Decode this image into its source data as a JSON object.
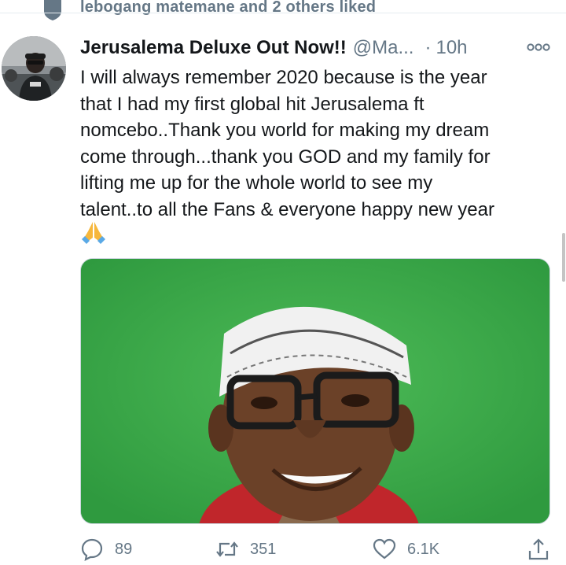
{
  "social_context": {
    "text": "lebogang matemane and 2 others liked",
    "icon": "heart-icon"
  },
  "tweet": {
    "display_name": "Jerusalema Deluxe Out Now!!",
    "handle": "@Ma...",
    "separator": "·",
    "time": "10h",
    "text": "I will always remember 2020 because is the year\nthat I had my first global hit Jerusalema ft\nnomcebo..Thank you world for making my dream\ncome through...thank you GOD and my family for\nlifting me up for the whole world to see my\ntalent..to all the Fans & everyone happy new year",
    "emoji": "folded-hands-emoji",
    "media_icon": "photo-portrait",
    "more_icon": "more-options-icon"
  },
  "actions": {
    "reply_count": "89",
    "retweet_count": "351",
    "like_count": "6.1K",
    "share_icon": "share-icon"
  },
  "colors": {
    "text": "#14171a",
    "secondary": "#657786",
    "divider": "#e6ecf0",
    "photo_background": "#3aa14a"
  }
}
